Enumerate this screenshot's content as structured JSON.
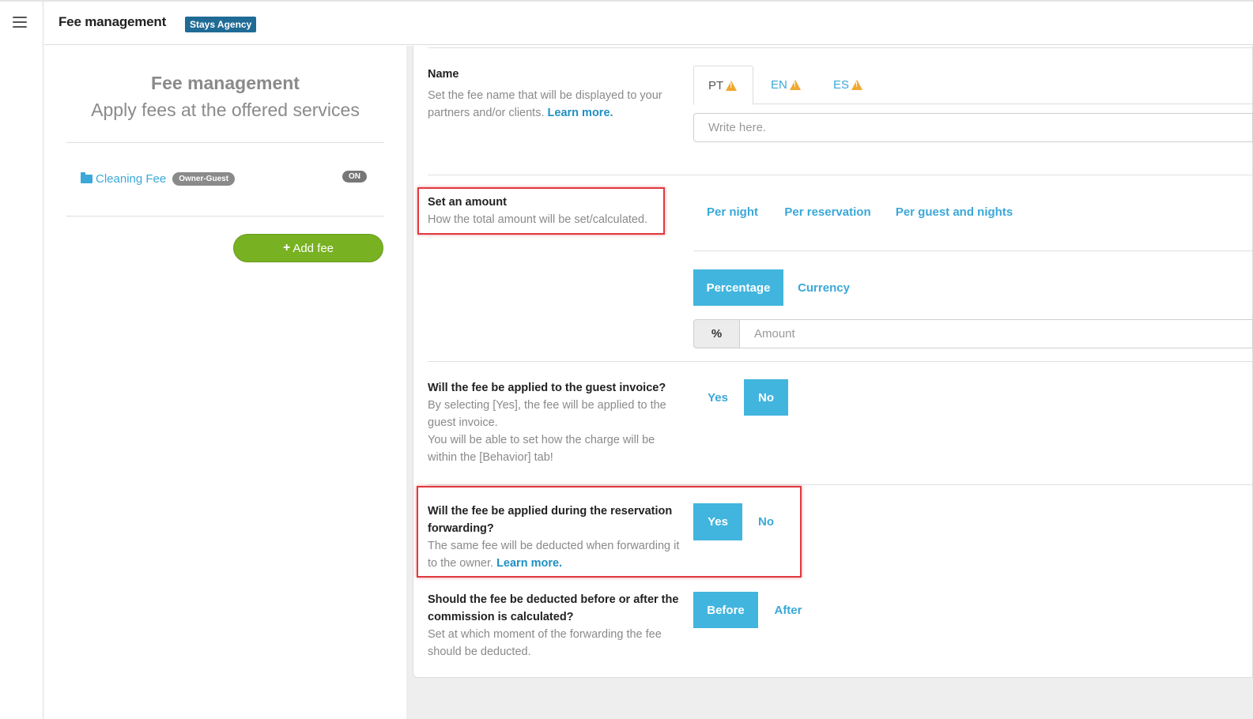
{
  "header": {
    "title": "Fee management",
    "agency_badge": "Stays Agency"
  },
  "left_panel": {
    "title": "Fee management",
    "subtitle": "Apply fees at the offered services",
    "fees": [
      {
        "name": "Cleaning Fee",
        "badge": "Owner-Guest",
        "status": "ON"
      }
    ],
    "add_button": "Add fee"
  },
  "name_section": {
    "label": "Name",
    "description": "Set the fee name that will be displayed to your partners and/or clients.",
    "learn_more": "Learn more.",
    "tabs": [
      "PT",
      "EN",
      "ES"
    ],
    "active_tab": "PT",
    "placeholder": "Write here."
  },
  "amount_section": {
    "label": "Set an amount",
    "description": "How the total amount will be set/calculated.",
    "modes": [
      "Per night",
      "Per reservation",
      "Per guest and nights"
    ],
    "types": [
      "Percentage",
      "Currency"
    ],
    "active_type": "Percentage",
    "addon": "%",
    "placeholder": "Amount"
  },
  "invoice_section": {
    "label": "Will the fee be applied to the guest invoice?",
    "description_1": "By selecting [Yes], the fee will be applied to the guest invoice.",
    "description_2": "You will be able to set how the charge will be within the [Behavior] tab!",
    "yes": "Yes",
    "no": "No",
    "selected": "No"
  },
  "forwarding_section": {
    "label": "Will the fee be applied during the reservation forwarding?",
    "description": "The same fee will be deducted when forwarding it to the owner.",
    "learn_more": "Learn more.",
    "yes": "Yes",
    "no": "No",
    "selected": "Yes"
  },
  "commission_section": {
    "label": "Should the fee be deducted before or after the commission is calculated?",
    "description": "Set at which moment of the forwarding the fee should be deducted.",
    "before": "Before",
    "after": "After",
    "selected": "Before"
  },
  "colors": {
    "accent": "#41b5de",
    "link": "#1f8fc2",
    "add_button": "#78b122",
    "agency_badge": "#1f6b95",
    "warning": "#f0a830",
    "highlight_box": "#e0393e"
  }
}
